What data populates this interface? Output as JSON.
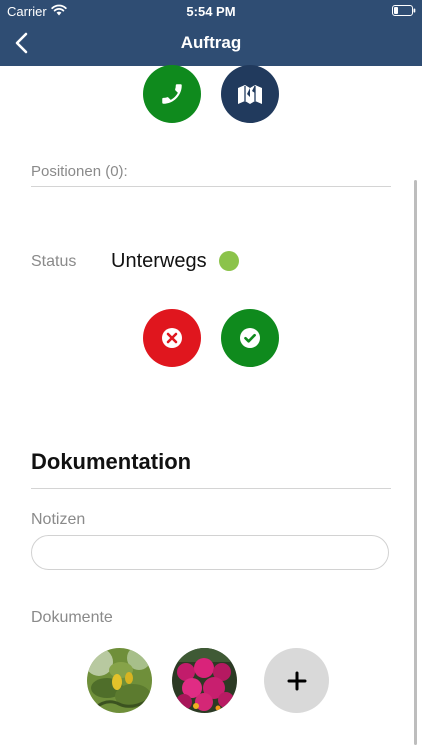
{
  "status_bar": {
    "carrier": "Carrier",
    "time": "5:54 PM"
  },
  "nav": {
    "title": "Auftrag",
    "back_icon": "chevron-left-icon"
  },
  "actions": {
    "call_icon": "phone-icon",
    "map_icon": "map-icon",
    "reject_icon": "close-circle-icon",
    "confirm_icon": "check-circle-icon"
  },
  "positions": {
    "label": "Positionen (0):"
  },
  "status": {
    "label": "Status",
    "value": "Unterwegs",
    "indicator_color": "#8bc34a"
  },
  "documentation": {
    "title": "Dokumentation",
    "notes_label": "Notizen",
    "notes_value": "",
    "documents_label": "Dokumente",
    "documents": [
      {
        "name": "lemon-tree-photo"
      },
      {
        "name": "flowers-photo"
      }
    ],
    "add_icon": "plus-icon"
  },
  "colors": {
    "nav_background": "#2f4d73",
    "green": "#0f8a1d",
    "navy": "#213a5d",
    "red": "#e0161e"
  }
}
